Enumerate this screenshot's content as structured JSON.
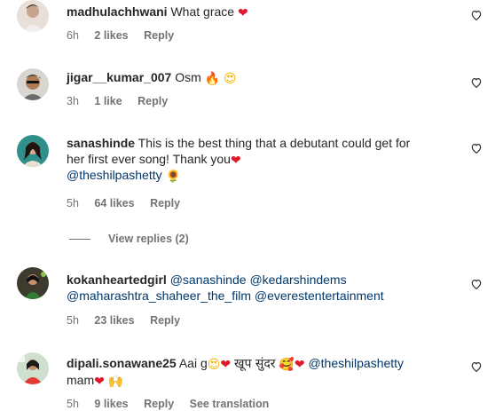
{
  "comments": [
    {
      "username": "madhulachhwani",
      "text": "What grace",
      "emoji_after": "❤",
      "time": "6h",
      "likes": "2 likes",
      "reply": "Reply"
    },
    {
      "username": "jigar__kumar_007",
      "text": "Osm",
      "emoji_1": "🔥",
      "emoji_2": "😍",
      "time": "3h",
      "likes": "1 like",
      "reply": "Reply"
    },
    {
      "username": "sanashinde",
      "text_line1": "This is the best thing that a debutant could get for",
      "text_line2": "her first ever song! Thank you",
      "emoji_heart": "❤",
      "mention": "@theshilpashetty",
      "emoji_flower": "🌻",
      "time": "5h",
      "likes": "64 likes",
      "reply": "Reply",
      "view_replies": "View replies (2)"
    },
    {
      "username": "kokanheartedgirl",
      "mention1": "@sanashinde",
      "mention2": "@kedarshindems",
      "mention3": "@maharashtra_shaheer_the_film",
      "mention4": "@everestentertainment",
      "time": "5h",
      "likes": "23 likes",
      "reply": "Reply"
    },
    {
      "username": "dipali.sonawane25",
      "text1": "Aai g",
      "emoji1": "😍",
      "emoji2": "❤",
      "text2": "खूप सुंदर",
      "emoji3": "🥰",
      "emoji4": "❤",
      "mention": "@theshilpashetty",
      "text3": "mam",
      "emoji5": "❤",
      "emoji6": "🙌",
      "time": "5h",
      "likes": "9 likes",
      "reply": "Reply",
      "see_translation": "See translation"
    }
  ],
  "colors": {
    "text": "#262626",
    "meta": "#737373",
    "mention": "#00376b",
    "heart": "#e0162b"
  },
  "icons": {
    "like": "heart-outline-icon"
  }
}
